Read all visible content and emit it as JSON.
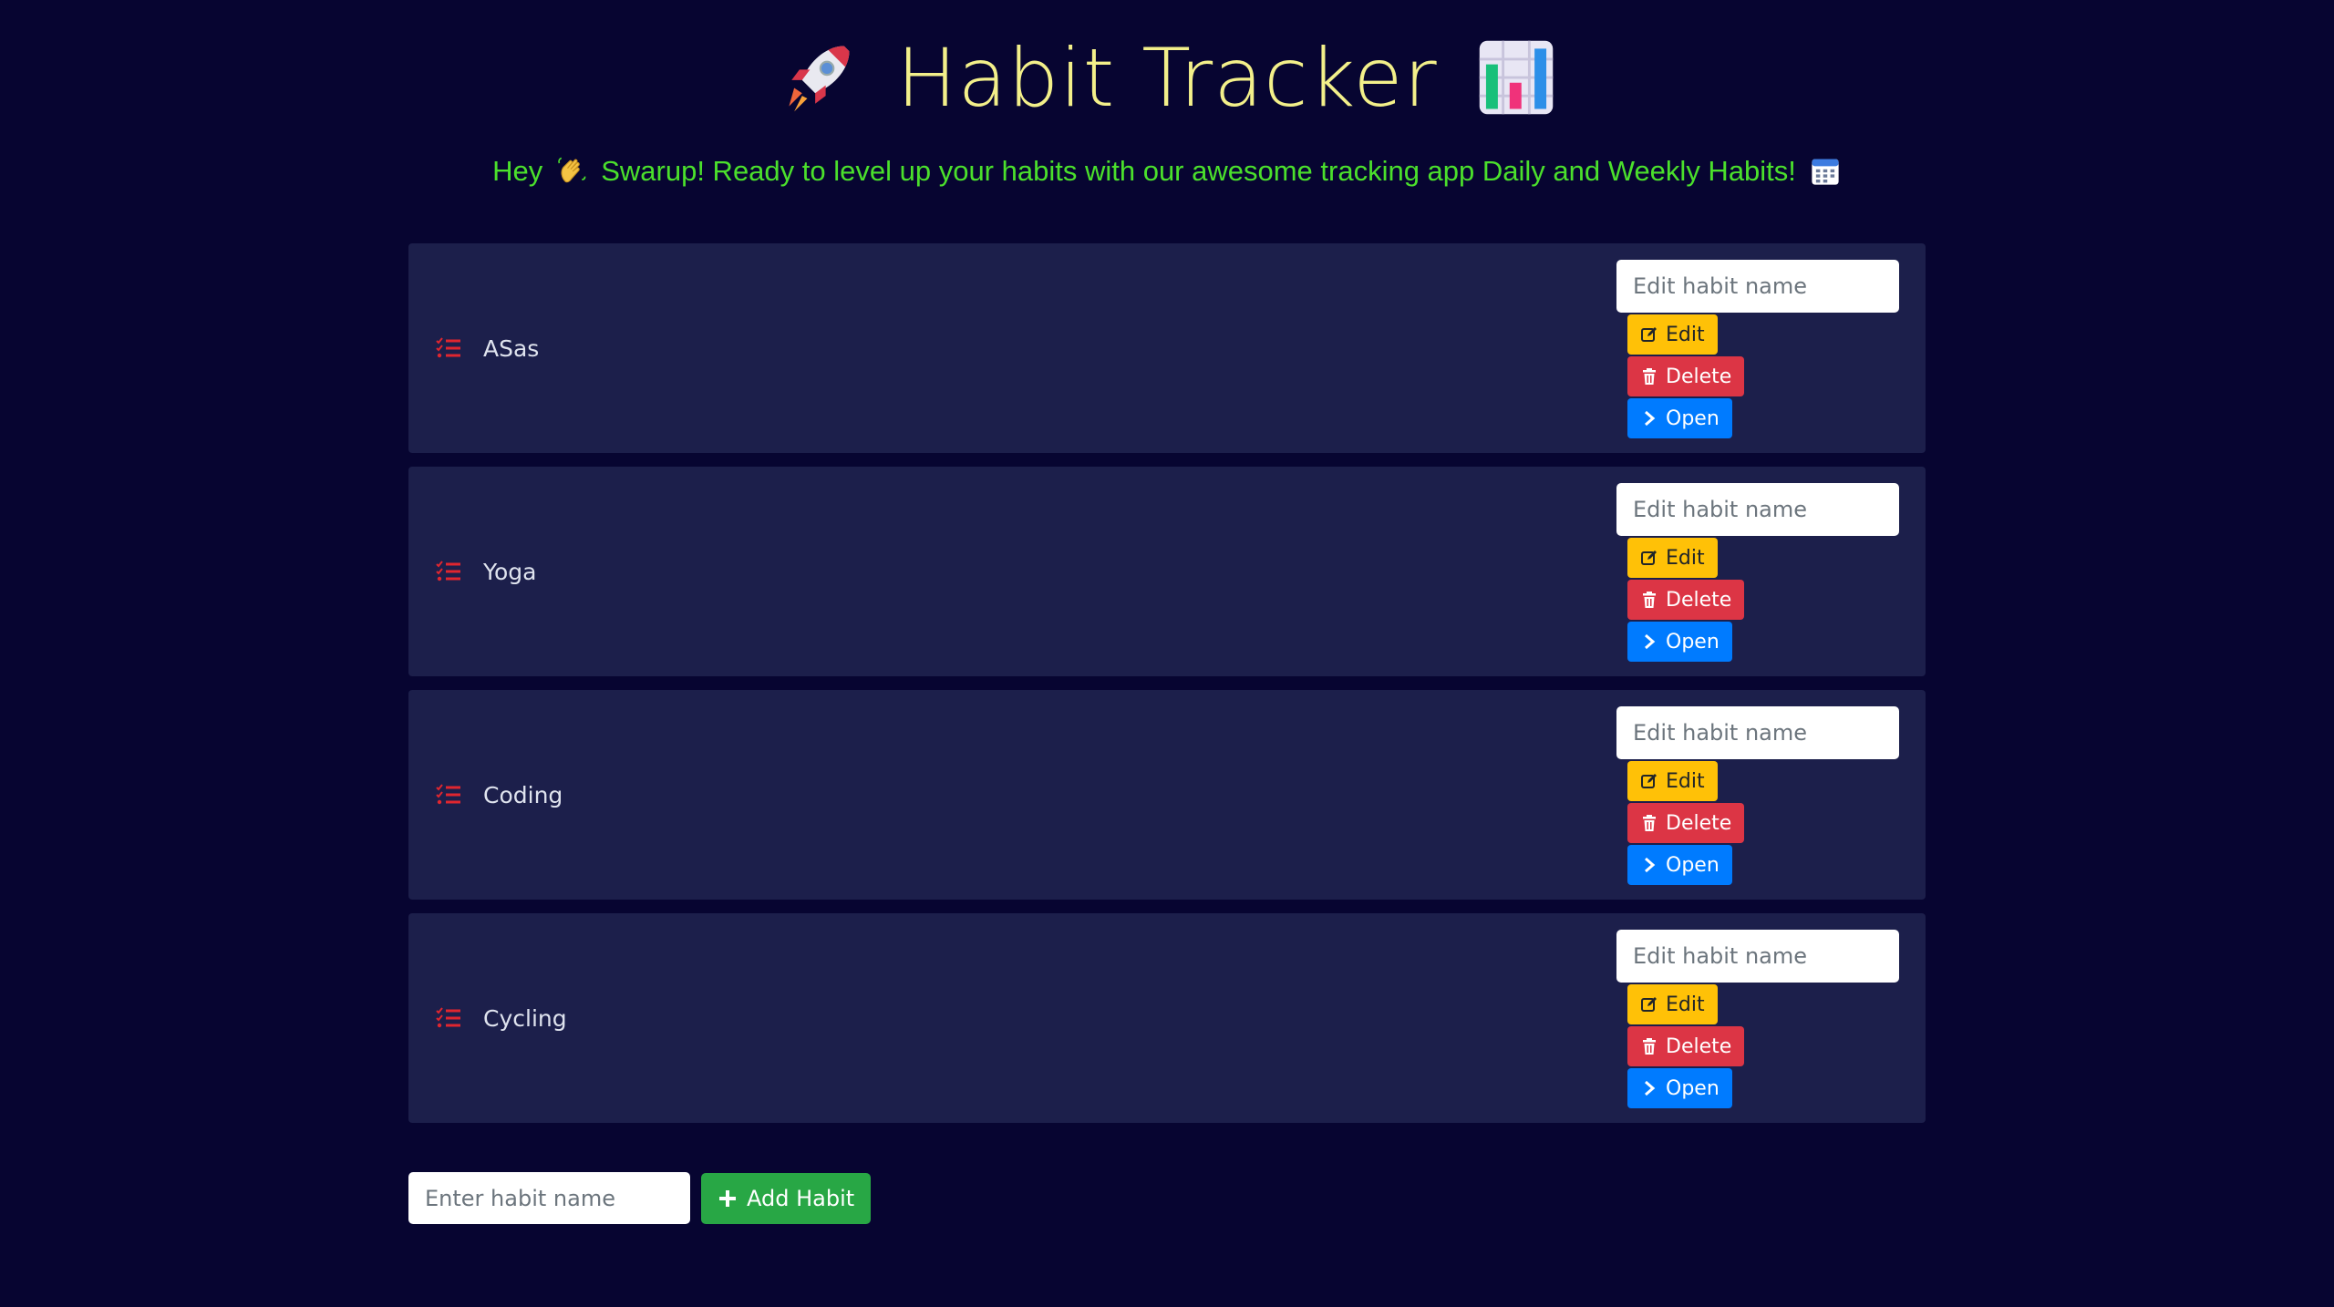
{
  "header": {
    "title": "Habit Tracker",
    "left_icon": "rocket-icon",
    "right_icon": "bar-chart-icon"
  },
  "subtitle": {
    "text_before": "Hey",
    "text_after": "Swarup! Ready to level up your habits with our awesome tracking app Daily and Weekly Habits!",
    "wave_icon": "waving-hand-icon",
    "calendar_icon": "calendar-icon"
  },
  "habit_actions": {
    "edit_placeholder": "Edit habit name",
    "edit_label": "Edit",
    "delete_label": "Delete",
    "open_label": "Open"
  },
  "habits": [
    {
      "name": "ASas"
    },
    {
      "name": "Yoga"
    },
    {
      "name": "Coding"
    },
    {
      "name": "Cycling"
    }
  ],
  "add": {
    "placeholder": "Enter habit name",
    "button_label": "Add Habit"
  },
  "colors": {
    "background": "#070531",
    "card": "#1c1f4b",
    "title": "#f3f08a",
    "subtitle": "#4be02c",
    "list_icon": "#e0262f",
    "edit": "#ffc107",
    "delete": "#dc3545",
    "open": "#007bff",
    "add": "#28a745"
  }
}
